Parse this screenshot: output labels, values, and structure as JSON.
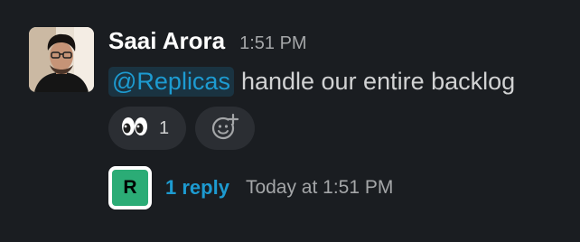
{
  "message": {
    "author": "Saai Arora",
    "timestamp": "1:51 PM",
    "mention": "@Replicas",
    "text": "handle our entire backlog"
  },
  "reactions": [
    {
      "emoji": "eyes",
      "count": "1"
    }
  ],
  "add_reaction_icon": "add-emoji-icon",
  "thread": {
    "avatar_letter": "R",
    "avatar_color": "#2bac76",
    "reply_count": "1 reply",
    "last_reply": "Today at 1:51 PM"
  },
  "colors": {
    "background": "#1a1d21",
    "link": "#1d9bd1",
    "mention_background": "#1d3b4c",
    "pill": "#2b2e33"
  }
}
